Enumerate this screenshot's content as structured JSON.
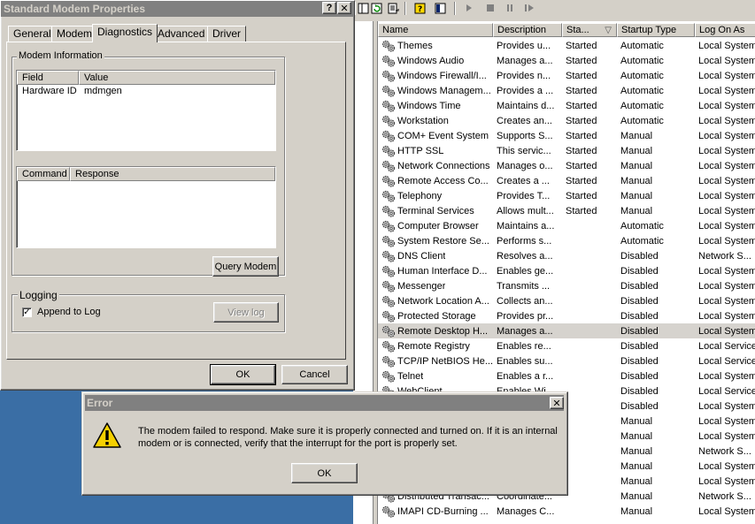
{
  "services": {
    "columns": [
      "Name",
      "Description",
      "Sta...",
      "Startup Type",
      "Log On As"
    ],
    "sort_indicator": "▽",
    "rows": [
      {
        "name": "Themes",
        "description": "Provides u...",
        "status": "Started",
        "startup": "Automatic",
        "logon": "Local System"
      },
      {
        "name": "Windows Audio",
        "description": "Manages a...",
        "status": "Started",
        "startup": "Automatic",
        "logon": "Local System"
      },
      {
        "name": "Windows Firewall/I...",
        "description": "Provides n...",
        "status": "Started",
        "startup": "Automatic",
        "logon": "Local System"
      },
      {
        "name": "Windows Managem...",
        "description": "Provides a ...",
        "status": "Started",
        "startup": "Automatic",
        "logon": "Local System"
      },
      {
        "name": "Windows Time",
        "description": "Maintains d...",
        "status": "Started",
        "startup": "Automatic",
        "logon": "Local System"
      },
      {
        "name": "Workstation",
        "description": "Creates an...",
        "status": "Started",
        "startup": "Automatic",
        "logon": "Local System"
      },
      {
        "name": "COM+ Event System",
        "description": "Supports S...",
        "status": "Started",
        "startup": "Manual",
        "logon": "Local System"
      },
      {
        "name": "HTTP SSL",
        "description": "This servic...",
        "status": "Started",
        "startup": "Manual",
        "logon": "Local System"
      },
      {
        "name": "Network Connections",
        "description": "Manages o...",
        "status": "Started",
        "startup": "Manual",
        "logon": "Local System"
      },
      {
        "name": "Remote Access Co...",
        "description": "Creates a ...",
        "status": "Started",
        "startup": "Manual",
        "logon": "Local System"
      },
      {
        "name": "Telephony",
        "description": "Provides T...",
        "status": "Started",
        "startup": "Manual",
        "logon": "Local System"
      },
      {
        "name": "Terminal Services",
        "description": "Allows mult...",
        "status": "Started",
        "startup": "Manual",
        "logon": "Local System"
      },
      {
        "name": "Computer Browser",
        "description": "Maintains a...",
        "status": "",
        "startup": "Automatic",
        "logon": "Local System"
      },
      {
        "name": "System Restore Se...",
        "description": "Performs s...",
        "status": "",
        "startup": "Automatic",
        "logon": "Local System"
      },
      {
        "name": "DNS Client",
        "description": "Resolves a...",
        "status": "",
        "startup": "Disabled",
        "logon": "Network S..."
      },
      {
        "name": "Human Interface D...",
        "description": "Enables ge...",
        "status": "",
        "startup": "Disabled",
        "logon": "Local System"
      },
      {
        "name": "Messenger",
        "description": "Transmits ...",
        "status": "",
        "startup": "Disabled",
        "logon": "Local System"
      },
      {
        "name": "Network Location A...",
        "description": "Collects an...",
        "status": "",
        "startup": "Disabled",
        "logon": "Local System"
      },
      {
        "name": "Protected Storage",
        "description": "Provides pr...",
        "status": "",
        "startup": "Disabled",
        "logon": "Local System"
      },
      {
        "name": "Remote Desktop H...",
        "description": "Manages a...",
        "status": "",
        "startup": "Disabled",
        "logon": "Local System"
      },
      {
        "name": "Remote Registry",
        "description": "Enables re...",
        "status": "",
        "startup": "Disabled",
        "logon": "Local Service"
      },
      {
        "name": "TCP/IP NetBIOS He...",
        "description": "Enables su...",
        "status": "",
        "startup": "Disabled",
        "logon": "Local Service"
      },
      {
        "name": "Telnet",
        "description": "Enables a r...",
        "status": "",
        "startup": "Disabled",
        "logon": "Local System"
      },
      {
        "name": "WebClient",
        "description": "Enables Wi...",
        "status": "",
        "startup": "Disabled",
        "logon": "Local Service"
      },
      {
        "name": "",
        "description": "",
        "status": "",
        "startup": "Disabled",
        "logon": "Local System"
      },
      {
        "name": "",
        "description": "",
        "status": "",
        "startup": "Manual",
        "logon": "Local System"
      },
      {
        "name": "",
        "description": "",
        "status": "",
        "startup": "Manual",
        "logon": "Local System"
      },
      {
        "name": "",
        "description": "",
        "status": "",
        "startup": "Manual",
        "logon": "Network S..."
      },
      {
        "name": "",
        "description": "",
        "status": "",
        "startup": "Manual",
        "logon": "Local System"
      },
      {
        "name": "",
        "description": "",
        "status": "",
        "startup": "Manual",
        "logon": "Local System"
      },
      {
        "name": "Distributed Transac...",
        "description": "Coordinate...",
        "status": "",
        "startup": "Manual",
        "logon": "Network S..."
      },
      {
        "name": "IMAPI CD-Burning ...",
        "description": "Manages C...",
        "status": "",
        "startup": "Manual",
        "logon": "Local System"
      }
    ],
    "selected_index": 19,
    "toolbar_icons": [
      "console-tree-icon",
      "refresh-icon",
      "export-list-icon",
      "help-icon",
      "properties-icon",
      "play-icon",
      "stop-icon",
      "pause-icon",
      "restart-icon"
    ]
  },
  "modem_dialog": {
    "title": "Standard Modem Properties",
    "help_glyph": "?",
    "close_glyph": "✕",
    "tabs": [
      "General",
      "Modem",
      "Diagnostics",
      "Advanced",
      "Driver"
    ],
    "active_tab": "Diagnostics",
    "modem_info_label": "Modem Information",
    "info_columns": [
      "Field",
      "Value"
    ],
    "info_rows": [
      {
        "field": "Hardware ID",
        "value": "mdmgen"
      }
    ],
    "command_columns": [
      "Command",
      "Response"
    ],
    "query_button": "Query Modem",
    "logging_label": "Logging",
    "append_label": "Append to Log",
    "append_checked": true,
    "view_log_button": "View log",
    "ok_button": "OK",
    "cancel_button": "Cancel"
  },
  "error_dialog": {
    "title": "Error",
    "close_glyph": "✕",
    "icon": "warning-icon",
    "message": "The modem failed to respond. Make sure it is properly connected and turned on.  If it is an internal modem or is connected, verify that the interrupt for the port is properly set.",
    "ok_button": "OK"
  },
  "colors": {
    "desktop": "#3a6ea5",
    "face": "#d4d0c8",
    "inactive_title": "#808080",
    "warning": "#f5d000"
  }
}
